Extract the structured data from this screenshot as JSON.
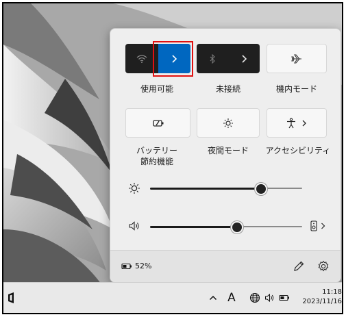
{
  "quick_settings": {
    "tiles": [
      {
        "label": "使用可能"
      },
      {
        "label": "未接続"
      },
      {
        "label": "機内モード"
      },
      {
        "label_line1": "バッテリー",
        "label_line2": "節約機能"
      },
      {
        "label": "夜間モード"
      },
      {
        "label": "アクセシビリティ"
      }
    ],
    "brightness_level": 0.73,
    "volume_level": 0.57,
    "battery_text": "52%"
  },
  "taskbar": {
    "ime_text": "A",
    "time": "11:18",
    "date": "2023/11/16"
  },
  "colors": {
    "accent": "#0067c0",
    "highlight": "#e01010"
  }
}
